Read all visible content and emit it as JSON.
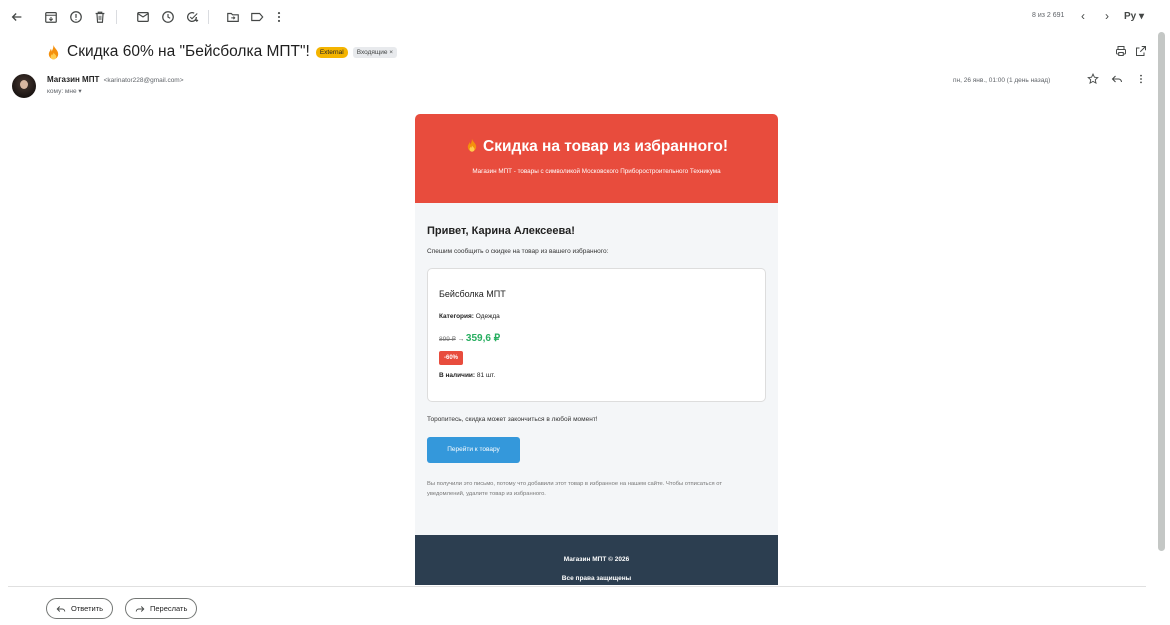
{
  "toolbar": {
    "back_icon": "arrow-left-icon",
    "icons": [
      "archive-icon",
      "report-spam-icon",
      "delete-icon",
      "mark-unread-icon",
      "snooze-icon",
      "add-task-icon",
      "move-to-icon",
      "label-icon",
      "more-vert-icon"
    ],
    "pager_text": "8 из 2 691",
    "prev": "‹",
    "next": "›",
    "lang_icon": "Pу ▾"
  },
  "subject": {
    "title": "Скидка 60% на \"Бейсболка МПТ\"!",
    "tag_external": "External",
    "tag_inbox": "Входящие ×"
  },
  "sender": {
    "name": "Магазин МПТ",
    "address": "<karinator228@gmail.com>",
    "to": "кому: мне ▾",
    "date": "пн, 26 янв., 01:00 (1 день назад)"
  },
  "email": {
    "header_title": "Скидка на товар из избранного!",
    "header_subtitle": "Магазин МПТ - товары с символикой Московского Приборостроительного Техникума",
    "greeting": "Привет, Карина Алексеева!",
    "intro": "Спешим сообщить о скидке на товар из вашего избранного:",
    "product": {
      "name": "Бейсболка МПТ",
      "category_label": "Категория:",
      "category_value": "Одежда",
      "old_price": "899 ₽",
      "arrow": "→",
      "new_price": "359,6 ₽",
      "discount": "-60%",
      "stock_label": "В наличии:",
      "stock_value": "81 шт."
    },
    "hurry": "Торопитесь, скидка может закончиться в любой момент!",
    "cta": "Перейти к товару",
    "note": "Вы получили это письмо, потому что добавили этот товар в избранное на нашем сайте. Чтобы отписаться от уведомлений, удалите товар из избранного.",
    "footer_line1": "Магазин МПТ © 2026",
    "footer_line2": "Все права защищены"
  },
  "actions": {
    "reply": "Ответить",
    "forward": "Переслать"
  },
  "colors": {
    "header_red": "#e84c3d",
    "price_green": "#27ae60",
    "button_blue": "#3498db",
    "footer_dark": "#2c3e50",
    "tag_yellow": "#f4b400"
  }
}
